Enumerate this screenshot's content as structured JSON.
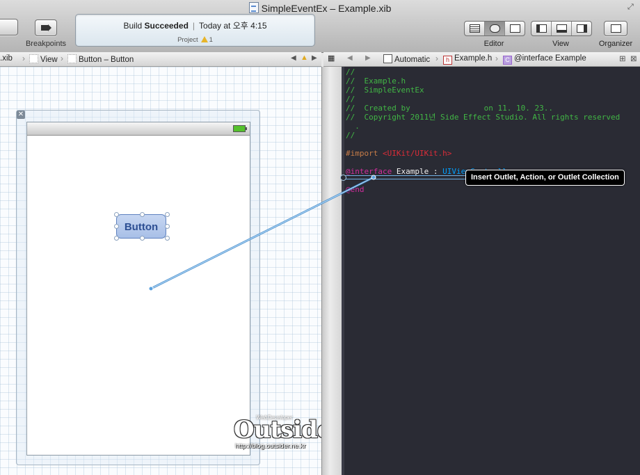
{
  "window": {
    "title": "SimpleEventEx – Example.xib"
  },
  "toolbar": {
    "breakpoints_label": "Breakpoints",
    "editor_label": "Editor",
    "view_label": "View",
    "organizer_label": "Organizer",
    "status": {
      "prefix": "Build",
      "result": "Succeeded",
      "time": "Today at 오후 4:15",
      "project_label": "Project",
      "warning_count": "1"
    }
  },
  "left_jumpbar": {
    "items": [
      ".xib",
      "View",
      "Button – Button"
    ]
  },
  "right_jumpbar": {
    "items": [
      "Automatic",
      "Example.h",
      "@interface Example"
    ]
  },
  "canvas": {
    "button_label": "Button",
    "close_glyph": "✕"
  },
  "code": {
    "lines": [
      "//",
      "//  Example.h",
      "//  SimpleEventEx",
      "//",
      "//  Created by                on 11. 10. 23..",
      "//  Copyright 2011년 Side Effect Studio. All rights reserved",
      "  .",
      "//",
      "",
      "#import",
      "<UIKit/UIKit.h>",
      "@interface",
      "Example :",
      "UIViewController",
      "@end"
    ]
  },
  "tooltip": {
    "text": "Insert Outlet, Action, or Outlet Collection"
  },
  "watermark": {
    "top": "WebDeveloper",
    "main": "Outsider",
    "url": "http://blog.outsider.ne.kr"
  },
  "colors": {
    "comment": "#41b645",
    "keyword": "#d22d9e",
    "preprocessor": "#c67c48",
    "string": "#db2c38",
    "type": "#00a0ff",
    "editor_bg": "#2a2b34",
    "connection_line": "#6faee0"
  }
}
